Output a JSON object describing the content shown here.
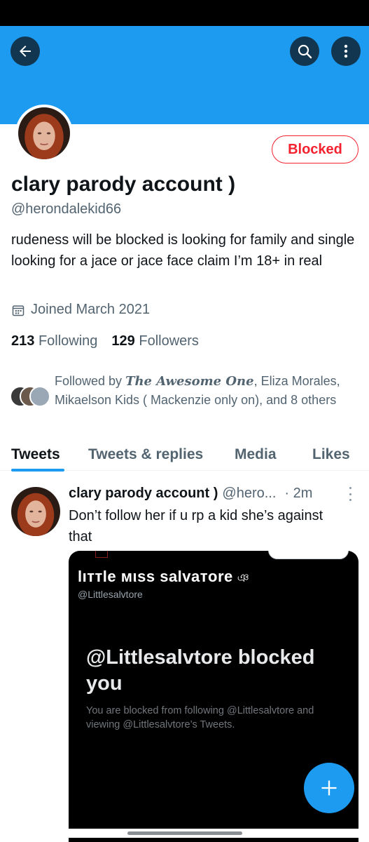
{
  "header": {
    "back_icon": "arrow-left-icon",
    "search_icon": "search-icon",
    "more_icon": "more-vertical-icon",
    "banner_color": "#1d9bf0"
  },
  "profile": {
    "action_button": "Blocked",
    "display_name": "clary parody account )",
    "handle": "@herondalekid66",
    "bio": "rudeness will be blocked is looking for family and single looking for a jace or jace face claim I’m 18+ in real",
    "joined": "Joined March 2021",
    "following_count": "213",
    "following_label": "Following",
    "followers_count": "129",
    "followers_label": "Followers",
    "followed_by_prefix": "Followed by ",
    "followed_by_name1": "The Awesome One",
    "followed_by_rest": ", Eliza Morales, Mikaelson Kids ( Mackenzie only on), and 8 others"
  },
  "tabs": [
    {
      "label": "Tweets",
      "active": true
    },
    {
      "label": "Tweets & replies",
      "active": false
    },
    {
      "label": "Media",
      "active": false
    },
    {
      "label": "Likes",
      "active": false
    }
  ],
  "tweet": {
    "name": "clary parody account )",
    "handle": "@hero...",
    "time": "· 2m",
    "text": "Don’t follow her if u rp a kid she’s against that",
    "media": {
      "name": "lıттle мιѕѕ ѕalvaтore",
      "name_icon": "ঞ",
      "handle": "@Littlesalvtore",
      "heading": "@Littlesalvtore blocked you",
      "subtext": "You are blocked from following @Littlesalvtore and viewing @Littlesalvtore’s Tweets."
    }
  },
  "fab": {
    "icon": "plus-icon"
  },
  "colors": {
    "accent": "#1d9bf0",
    "blocked_red": "#f4212e",
    "secondary_text": "#536471"
  }
}
